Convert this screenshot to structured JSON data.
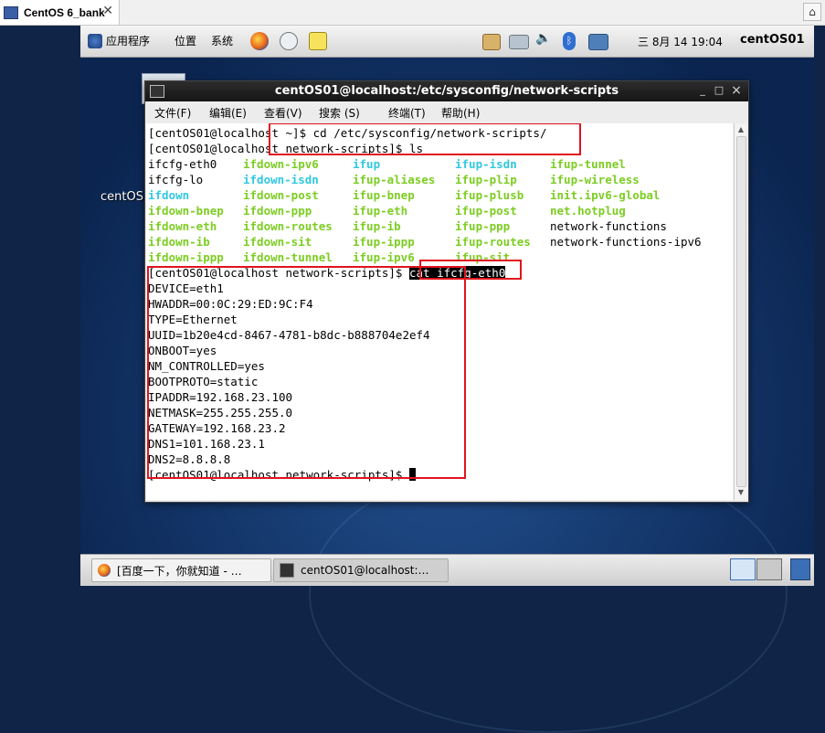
{
  "host": {
    "tab_title": "CentOS 6_bank",
    "close_glyph": "✕",
    "home_glyph": "⌂"
  },
  "top_panel": {
    "menus": [
      "应用程序",
      "位置",
      "系统"
    ],
    "clock": "三 8月 14 19:04",
    "user": "centOS01",
    "icons": [
      "firefox-icon",
      "mail-icon",
      "notes-icon",
      "printer-icon",
      "network-icon",
      "volume-icon",
      "bluetooth-icon",
      "display-icon"
    ]
  },
  "desktop": {
    "icon_label": "centOS"
  },
  "terminal": {
    "title": "centOS01@localhost:/etc/sysconfig/network-scripts",
    "menus": [
      "文件(F)",
      "编辑(E)",
      "查看(V)",
      "搜索 (S)",
      "终端(T)",
      "帮助(H)"
    ],
    "buttons": {
      "minimize": "_",
      "maximize": "□",
      "close": "×"
    },
    "lines": {
      "l1": "[centOS01@localhost ~]$ cd /etc/sysconfig/network-scripts/",
      "l2": "[centOS01@localhost network-scripts]$ ls",
      "prompt3": "[centOS01@localhost network-scripts]$ ",
      "cmd3": "cat ifcfg-eth0",
      "prompt_final": "[centOS01@localhost network-scripts]$ "
    },
    "ls_columns": [
      [
        {
          "name": "ifcfg-eth0",
          "color": "#000000"
        },
        {
          "name": "ifcfg-lo",
          "color": "#000000"
        },
        {
          "name": "ifdown",
          "color": "#30c8e0"
        },
        {
          "name": "ifdown-bnep",
          "color": "#7ccd22"
        },
        {
          "name": "ifdown-eth",
          "color": "#7ccd22"
        },
        {
          "name": "ifdown-ib",
          "color": "#7ccd22"
        },
        {
          "name": "ifdown-ippp",
          "color": "#7ccd22"
        }
      ],
      [
        {
          "name": "ifdown-ipv6",
          "color": "#7ccd22"
        },
        {
          "name": "ifdown-isdn",
          "color": "#30c8e0"
        },
        {
          "name": "ifdown-post",
          "color": "#7ccd22"
        },
        {
          "name": "ifdown-ppp",
          "color": "#7ccd22"
        },
        {
          "name": "ifdown-routes",
          "color": "#7ccd22"
        },
        {
          "name": "ifdown-sit",
          "color": "#7ccd22"
        },
        {
          "name": "ifdown-tunnel",
          "color": "#7ccd22"
        }
      ],
      [
        {
          "name": "ifup",
          "color": "#30c8e0"
        },
        {
          "name": "ifup-aliases",
          "color": "#7ccd22"
        },
        {
          "name": "ifup-bnep",
          "color": "#7ccd22"
        },
        {
          "name": "ifup-eth",
          "color": "#7ccd22"
        },
        {
          "name": "ifup-ib",
          "color": "#7ccd22"
        },
        {
          "name": "ifup-ippp",
          "color": "#7ccd22"
        },
        {
          "name": "ifup-ipv6",
          "color": "#7ccd22"
        }
      ],
      [
        {
          "name": "ifup-isdn",
          "color": "#30c8e0"
        },
        {
          "name": "ifup-plip",
          "color": "#7ccd22"
        },
        {
          "name": "ifup-plusb",
          "color": "#7ccd22"
        },
        {
          "name": "ifup-post",
          "color": "#7ccd22"
        },
        {
          "name": "ifup-ppp",
          "color": "#7ccd22"
        },
        {
          "name": "ifup-routes",
          "color": "#7ccd22"
        },
        {
          "name": "ifup-sit",
          "color": "#7ccd22"
        }
      ],
      [
        {
          "name": "ifup-tunnel",
          "color": "#7ccd22"
        },
        {
          "name": "ifup-wireless",
          "color": "#7ccd22"
        },
        {
          "name": "init.ipv6-global",
          "color": "#7ccd22"
        },
        {
          "name": "net.hotplug",
          "color": "#7ccd22"
        },
        {
          "name": "network-functions",
          "color": "#000000"
        },
        {
          "name": "network-functions-ipv6",
          "color": "#000000"
        }
      ]
    ],
    "config_lines": [
      "DEVICE=eth1",
      "HWADDR=00:0C:29:ED:9C:F4",
      "TYPE=Ethernet",
      "UUID=1b20e4cd-8467-4781-b8dc-b888704e2ef4",
      "ONBOOT=yes",
      "NM_CONTROLLED=yes",
      "BOOTPROTO=static",
      "IPADDR=192.168.23.100",
      "NETMASK=255.255.255.0",
      "GATEWAY=192.168.23.2",
      "DNS1=101.168.23.1",
      "DNS2=8.8.8.8"
    ]
  },
  "taskbar": {
    "tasks": [
      {
        "label": "[百度一下，你就知道 - …",
        "icon": "firefox-icon",
        "active": false
      },
      {
        "label": "centOS01@localhost:…",
        "icon": "terminal-icon",
        "active": true
      }
    ]
  },
  "colors": {
    "highlight": "#e0141e",
    "ls_green": "#7ccd22",
    "ls_cyan": "#30c8e0"
  }
}
